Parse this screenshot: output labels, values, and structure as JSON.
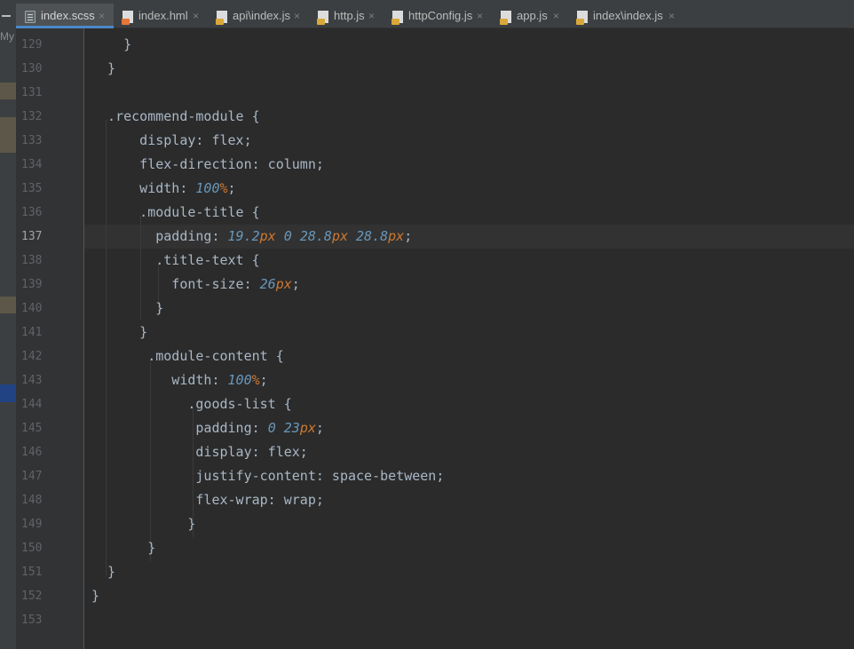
{
  "tabs": [
    {
      "label": "index.scss",
      "icon": "scss-file-icon",
      "active": true
    },
    {
      "label": "index.hml",
      "icon": "html-file-icon",
      "active": false
    },
    {
      "label": "api\\index.js",
      "icon": "js-file-icon",
      "active": false
    },
    {
      "label": "http.js",
      "icon": "js-file-icon",
      "active": false
    },
    {
      "label": "httpConfig.js",
      "icon": "js-file-icon",
      "active": false
    },
    {
      "label": "app.js",
      "icon": "js-file-icon",
      "active": false
    },
    {
      "label": "index\\index.js",
      "icon": "js-file-icon",
      "active": false
    }
  ],
  "tab_close_glyph": "×",
  "side_label": "My",
  "current_line": "137",
  "lines": [
    {
      "n": "129",
      "text": "    }"
    },
    {
      "n": "130",
      "text": "  }"
    },
    {
      "n": "131",
      "text": ""
    },
    {
      "n": "132",
      "text": "  .recommend-module {"
    },
    {
      "n": "133",
      "text": "      display: flex;"
    },
    {
      "n": "134",
      "text": "      flex-direction: column;"
    },
    {
      "n": "135",
      "text": "      width: 100%;"
    },
    {
      "n": "136",
      "text": "      .module-title {"
    },
    {
      "n": "137",
      "text": "        padding: 19.2px 0 28.8px 28.8px;"
    },
    {
      "n": "138",
      "text": "        .title-text {"
    },
    {
      "n": "139",
      "text": "          font-size: 26px;"
    },
    {
      "n": "140",
      "text": "        }"
    },
    {
      "n": "141",
      "text": "      }"
    },
    {
      "n": "142",
      "text": "       .module-content {"
    },
    {
      "n": "143",
      "text": "          width: 100%;"
    },
    {
      "n": "144",
      "text": "            .goods-list {"
    },
    {
      "n": "145",
      "text": "             padding: 0 23px;"
    },
    {
      "n": "146",
      "text": "             display: flex;"
    },
    {
      "n": "147",
      "text": "             justify-content: space-between;"
    },
    {
      "n": "148",
      "text": "             flex-wrap: wrap;"
    },
    {
      "n": "149",
      "text": "            }"
    },
    {
      "n": "150",
      "text": "       }"
    },
    {
      "n": "151",
      "text": "  }"
    },
    {
      "n": "152",
      "text": "}"
    },
    {
      "n": "153",
      "text": ""
    }
  ],
  "colors": {
    "background": "#2b2b2b",
    "gutter": "#313335",
    "tabbar": "#3c3f41",
    "active_tab_underline": "#4a88c7",
    "number": "#6897bb",
    "unit": "#cc7832",
    "text": "#a9b7c6"
  }
}
